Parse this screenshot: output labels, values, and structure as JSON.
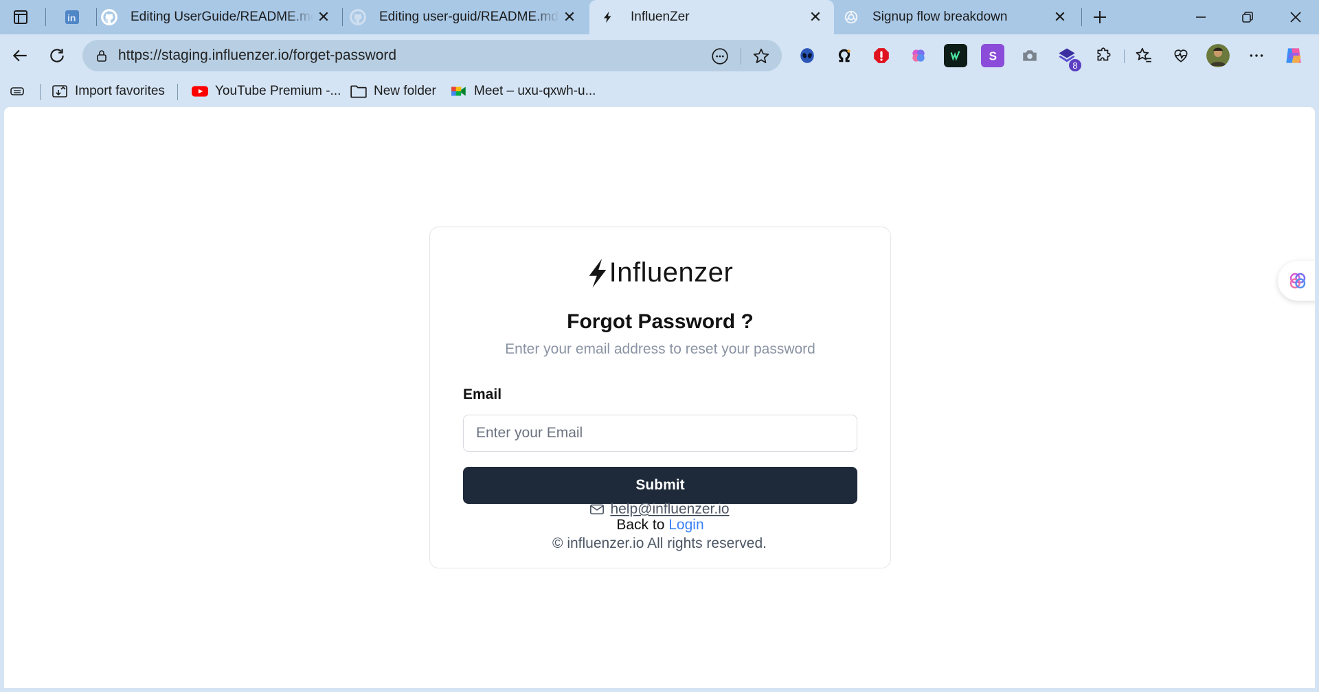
{
  "browser": {
    "tabs": [
      {
        "title": "",
        "icon": "linkedin-icon",
        "active": false
      },
      {
        "title": "Editing UserGuide/README.md at",
        "icon": "github-icon",
        "active": false
      },
      {
        "title": "Editing user-guid/README.md at",
        "icon": "github-icon",
        "active": false
      },
      {
        "title": "InfluenZer",
        "icon": "bolt-icon",
        "active": true
      },
      {
        "title": "Signup flow breakdown",
        "icon": "openai-icon",
        "active": false
      }
    ],
    "url": "https://staging.influenzer.io/forget-password",
    "extension_badge": "8",
    "bookmarks": [
      {
        "label": "Import favorites",
        "icon": "import-icon"
      },
      {
        "label": "YouTube Premium -...",
        "icon": "youtube-icon"
      },
      {
        "label": "New folder",
        "icon": "folder-icon"
      },
      {
        "label": "Meet – uxu-qxwh-u...",
        "icon": "meet-icon"
      }
    ]
  },
  "page": {
    "brand": "Influenzer",
    "title": "Forgot Password ?",
    "subtitle": "Enter your email address to reset your password",
    "email_label": "Email",
    "email_placeholder": "Enter your Email",
    "email_value": "",
    "submit_label": "Submit",
    "back_text": "Back to",
    "login_link": "Login",
    "support_email": "help@influenzer.io",
    "copyright": "© influenzer.io All rights reserved."
  },
  "colors": {
    "button_bg": "#1e2939",
    "link": "#3b82f6",
    "subtitle": "#8a93a3",
    "tabbar": "#a9c8e6",
    "chrome": "#d4e4f4"
  }
}
